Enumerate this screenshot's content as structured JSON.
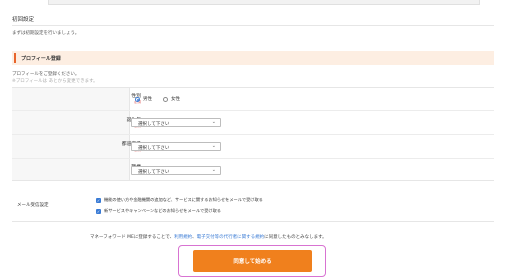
{
  "page": {
    "title": "初回設定",
    "intro": "まずは初期設定を行いましょう。"
  },
  "profile": {
    "heading": "プロフィール登録",
    "note": "プロフィールをご登録ください。",
    "note_sub": "※プロフィールは あとから変更できます。",
    "required_label": "必須",
    "gender": {
      "label": "性別",
      "options": [
        "男性",
        "女性"
      ],
      "selected": "男性"
    },
    "birth_year": {
      "label": "誕生年",
      "value": "選択して下さい"
    },
    "age_group": {
      "label": "都道府県",
      "value": "選択して下さい"
    },
    "occupation": {
      "label": "職業",
      "value": "選択して下さい"
    }
  },
  "email_settings": {
    "label": "メール受信設定",
    "options": [
      "機能の使い方や金融機関の追加など、サービスに関するお知らせをメールで受け取る",
      "新サービスやキャンペーンなどのお知らせをメールで受け取る"
    ]
  },
  "agreement": {
    "prefix": "マネーフォワード MEに登録することで、",
    "link_terms": "利用規約",
    "separator": "、",
    "link_privacy": "電子交付等の代行者に関する規約",
    "suffix": "に同意したものとみなします。"
  },
  "cta": {
    "label": "同意して始める"
  },
  "colors": {
    "accent": "#e8642b",
    "cta": "#f0801d",
    "link": "#3a7bd5",
    "focus": "#d873d2"
  }
}
